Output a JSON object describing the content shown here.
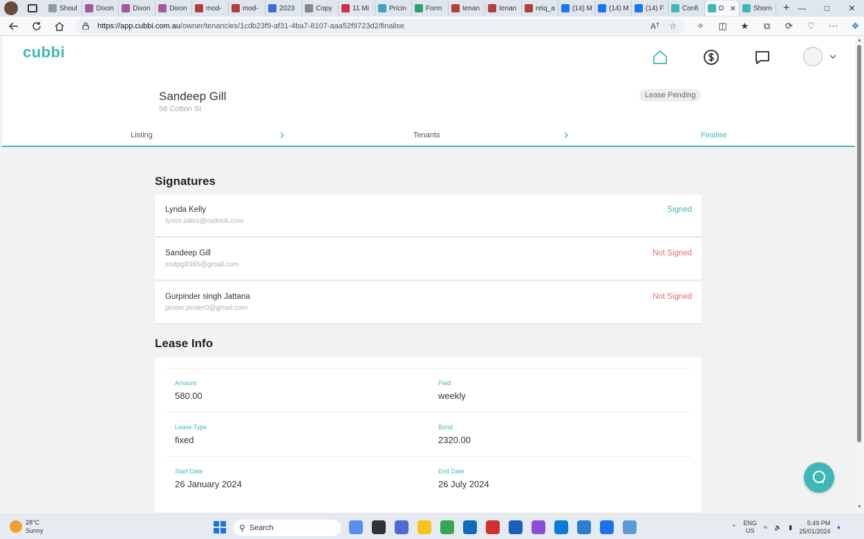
{
  "browser": {
    "tabs": [
      {
        "label": "Shoul",
        "color": "#8a9aa8"
      },
      {
        "label": "Dixon",
        "color": "#a25a9a"
      },
      {
        "label": "Dixon",
        "color": "#a25a9a"
      },
      {
        "label": "Dixon",
        "color": "#a25a9a"
      },
      {
        "label": "mod-",
        "color": "#b04040"
      },
      {
        "label": "mod-",
        "color": "#b04040"
      },
      {
        "label": "2023",
        "color": "#3a6fd0"
      },
      {
        "label": "Copy",
        "color": "#888888"
      },
      {
        "label": "11 Mi",
        "color": "#d03050"
      },
      {
        "label": "Pricin",
        "color": "#40a0c0"
      },
      {
        "label": "Form",
        "color": "#30a070"
      },
      {
        "label": "tenan",
        "color": "#b04040"
      },
      {
        "label": "tenan",
        "color": "#b04040"
      },
      {
        "label": "reiq_a",
        "color": "#b04040"
      },
      {
        "label": "(14) M",
        "color": "#1877f2"
      },
      {
        "label": "(14) M",
        "color": "#1877f2"
      },
      {
        "label": "(14) F",
        "color": "#1877f2"
      },
      {
        "label": "Confi",
        "color": "#3fb7b6"
      },
      {
        "label": "D",
        "color": "#3fb7b6",
        "active": true
      },
      {
        "label": "Shorn",
        "color": "#3fb7b6"
      }
    ],
    "new_tab": "+",
    "url_host": "https://app.cubbi.com.au",
    "url_path": "/owner/tenancies/1cdb23f9-af31-4ba7-8107-aaa52f9723d2/finalise",
    "read_aloud": "Aᵀ"
  },
  "app": {
    "logo": "cubbi",
    "accent": "#3fb7b6",
    "tenant_name": "Sandeep Gill",
    "address": "58 Cotton St",
    "status": "Lease Pending",
    "steps": [
      "Listing",
      "Tenants",
      "Finalise"
    ]
  },
  "signatures": {
    "title": "Signatures",
    "items": [
      {
        "name": "Lynda Kelly",
        "email": "lynco.sales@outlook.com",
        "status": "Signed",
        "signed": true
      },
      {
        "name": "Sandeep Gill",
        "email": "sndpgill365@gmail.com",
        "status": "Not Signed",
        "signed": false
      },
      {
        "name": "Gurpinder singh Jattana",
        "email": "pinder.pinder0@gmail.com",
        "status": "Not Signed",
        "signed": false
      }
    ]
  },
  "lease_info": {
    "title": "Lease Info",
    "rows": [
      [
        {
          "label": "Amount",
          "value": "580.00"
        },
        {
          "label": "Paid",
          "value": "weekly"
        }
      ],
      [
        {
          "label": "Lease Type",
          "value": "fixed"
        },
        {
          "label": "Bond",
          "value": "2320.00"
        }
      ],
      [
        {
          "label": "Start Date",
          "value": "26 January 2024"
        },
        {
          "label": "End Date",
          "value": "26 July 2024"
        }
      ]
    ]
  },
  "taskbar": {
    "temperature": "28°C",
    "weather": "Sunny",
    "search_placeholder": "Search",
    "lang_top": "ENG",
    "lang_bottom": "US",
    "time": "5:49 PM",
    "date": "25/01/2024",
    "apps": [
      "#5b8def",
      "#333333",
      "#4a6cd4",
      "#f5c518",
      "#34a853",
      "#0f6cbd",
      "#d0312d",
      "#1b5ebe",
      "#8a4fd8",
      "#0a7bd6",
      "#2b7fd0",
      "#1a73e8",
      "#5a9bd5"
    ]
  }
}
